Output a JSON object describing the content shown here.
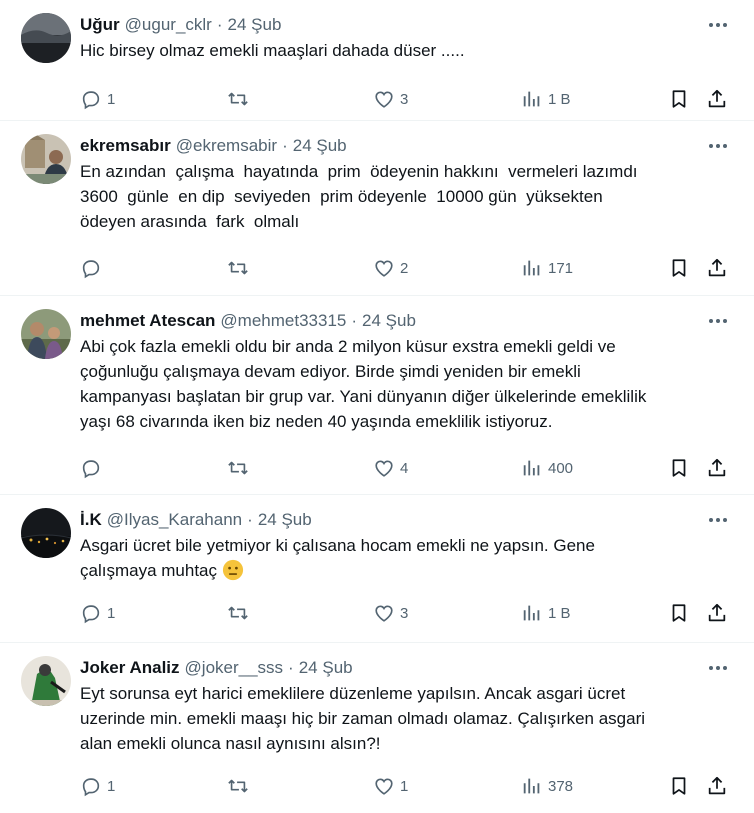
{
  "tweets": [
    {
      "name": "Uğur",
      "handle": "@ugur_cklr",
      "separator": "·",
      "date": "24 Şub",
      "text": "Hic birsey olmaz emekli maaşlari dahada düser .....",
      "replies": "1",
      "retweets": "",
      "likes": "3",
      "views": "1 B",
      "avatar": "dark-sky"
    },
    {
      "name": "ekremsabır",
      "handle": "@ekremsabir",
      "separator": "·",
      "date": "24 Şub",
      "text": "En azından  çalışma  hayatında  prim  ödeyenin hakkını  vermeleri lazımdı\n3600  günle  en dip  seviyeden  prim ödeyenle  10000 gün  yüksekten\nödeyen arasında  fark  olmalı",
      "replies": "",
      "retweets": "",
      "likes": "2",
      "views": "171",
      "avatar": "man-building"
    },
    {
      "name": "mehmet Atescan",
      "handle": "@mehmet33315",
      "separator": "·",
      "date": "24 Şub",
      "text": "Abi çok fazla emekli oldu bir anda 2 milyon küsur exstra emekli geldi ve\nçoğunluğu çalışmaya devam ediyor. Birde şimdi yeniden bir emekli\nkampanyası başlatan bir grup var. Yani dünyanın diğer ülkelerinde emeklilik\nyaşı 68 civarında iken biz neden 40 yaşında emeklilik istiyoruz.",
      "replies": "",
      "retweets": "",
      "likes": "4",
      "views": "400",
      "avatar": "family"
    },
    {
      "name": "İ.K",
      "handle": "@Ilyas_Karahann",
      "separator": "·",
      "date": "24 Şub",
      "text": "Asgari ücret bile yetmiyor ki çalısana hocam emekli ne yapsın. Gene\nçalışmaya muhtaç ",
      "emoji": "neutral-face",
      "replies": "1",
      "retweets": "",
      "likes": "3",
      "views": "1 B",
      "avatar": "night-city"
    },
    {
      "name": "Joker Analiz",
      "handle": "@joker__sss",
      "separator": "·",
      "date": "24 Şub",
      "text": "Eyt sorunsa eyt harici emeklilere düzenleme yapılsın. Ancak asgari ücret\nuzerinde min. emekli maaşı hiç bir zaman olmadı olamaz. Çalışırken asgari\nalan emekli olunca nasıl aynısını alsın?!",
      "replies": "1",
      "retweets": "",
      "likes": "1",
      "views": "378",
      "avatar": "green-figure"
    }
  ],
  "colors": {
    "text": "#0f1419",
    "muted": "#536471",
    "divider": "#eff3f4",
    "emoji": "#f5c33b"
  }
}
